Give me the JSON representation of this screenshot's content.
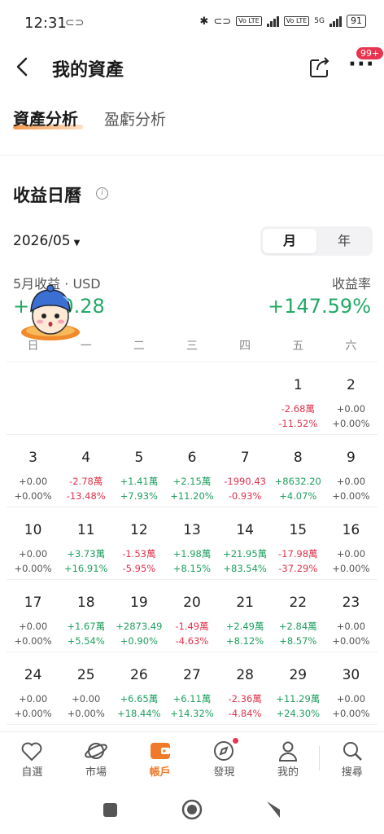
{
  "status": {
    "time": "12:31",
    "battery": "91",
    "net": "5G",
    "lte": "Vo LTE"
  },
  "header": {
    "title": "我的資產",
    "badge": "99+"
  },
  "tabs": [
    "資產分析",
    "盈虧分析"
  ],
  "section": {
    "title": "收益日曆",
    "info": "i"
  },
  "month_selector": "2026/05",
  "segment": {
    "month": "月",
    "year": "年"
  },
  "summary": {
    "label": "5月收益 · USD",
    "amount": "+…20.28",
    "rate_label": "收益率",
    "rate": "+147.59%"
  },
  "weekdays": [
    "日",
    "一",
    "二",
    "三",
    "四",
    "五",
    "六"
  ],
  "weeks": [
    [
      null,
      null,
      null,
      null,
      null,
      {
        "day": "1",
        "value": "-2.68萬",
        "pct": "-11.52%",
        "s": "neg"
      },
      {
        "day": "2",
        "value": "+0.00",
        "pct": "+0.00%",
        "s": "zero"
      }
    ],
    [
      {
        "day": "3",
        "value": "+0.00",
        "pct": "+0.00%",
        "s": "zero"
      },
      {
        "day": "4",
        "value": "-2.78萬",
        "pct": "-13.48%",
        "s": "neg"
      },
      {
        "day": "5",
        "value": "+1.41萬",
        "pct": "+7.93%",
        "s": "pos"
      },
      {
        "day": "6",
        "value": "+2.15萬",
        "pct": "+11.20%",
        "s": "pos"
      },
      {
        "day": "7",
        "value": "-1990.43",
        "pct": "-0.93%",
        "s": "neg"
      },
      {
        "day": "8",
        "value": "+8632.20",
        "pct": "+4.07%",
        "s": "pos"
      },
      {
        "day": "9",
        "value": "+0.00",
        "pct": "+0.00%",
        "s": "zero"
      }
    ],
    [
      {
        "day": "10",
        "value": "+0.00",
        "pct": "+0.00%",
        "s": "zero"
      },
      {
        "day": "11",
        "value": "+3.73萬",
        "pct": "+16.91%",
        "s": "pos"
      },
      {
        "day": "12",
        "value": "-1.53萬",
        "pct": "-5.95%",
        "s": "neg"
      },
      {
        "day": "13",
        "value": "+1.98萬",
        "pct": "+8.15%",
        "s": "pos"
      },
      {
        "day": "14",
        "value": "+21.95萬",
        "pct": "+83.54%",
        "s": "pos"
      },
      {
        "day": "15",
        "value": "-17.98萬",
        "pct": "-37.29%",
        "s": "neg"
      },
      {
        "day": "16",
        "value": "+0.00",
        "pct": "+0.00%",
        "s": "zero"
      }
    ],
    [
      {
        "day": "17",
        "value": "+0.00",
        "pct": "+0.00%",
        "s": "zero"
      },
      {
        "day": "18",
        "value": "+1.67萬",
        "pct": "+5.54%",
        "s": "pos"
      },
      {
        "day": "19",
        "value": "+2873.49",
        "pct": "+0.90%",
        "s": "pos"
      },
      {
        "day": "20",
        "value": "-1.49萬",
        "pct": "-4.63%",
        "s": "neg"
      },
      {
        "day": "21",
        "value": "+2.49萬",
        "pct": "+8.12%",
        "s": "pos"
      },
      {
        "day": "22",
        "value": "+2.84萬",
        "pct": "+8.57%",
        "s": "pos"
      },
      {
        "day": "23",
        "value": "+0.00",
        "pct": "+0.00%",
        "s": "zero"
      }
    ],
    [
      {
        "day": "24",
        "value": "+0.00",
        "pct": "+0.00%",
        "s": "zero"
      },
      {
        "day": "25",
        "value": "+0.00",
        "pct": "+0.00%",
        "s": "zero"
      },
      {
        "day": "26",
        "value": "+6.65萬",
        "pct": "+18.44%",
        "s": "pos"
      },
      {
        "day": "27",
        "value": "+6.11萬",
        "pct": "+14.32%",
        "s": "pos"
      },
      {
        "day": "28",
        "value": "-2.36萬",
        "pct": "-4.84%",
        "s": "neg"
      },
      {
        "day": "29",
        "value": "+11.29萬",
        "pct": "+24.30%",
        "s": "pos"
      },
      {
        "day": "30",
        "value": "+0.00",
        "pct": "+0.00%",
        "s": "zero"
      }
    ]
  ],
  "nav": [
    {
      "label": "自選",
      "icon": "heart-icon"
    },
    {
      "label": "市場",
      "icon": "planet-icon"
    },
    {
      "label": "帳戶",
      "icon": "wallet-icon",
      "active": true
    },
    {
      "label": "發現",
      "icon": "compass-icon"
    },
    {
      "label": "我的",
      "icon": "person-icon"
    },
    {
      "label": "搜尋",
      "icon": "search-icon"
    }
  ],
  "colors": {
    "positive": "#20a060",
    "negative": "#e0334d",
    "accent": "#f07a2a",
    "badge": "#e8344e"
  }
}
